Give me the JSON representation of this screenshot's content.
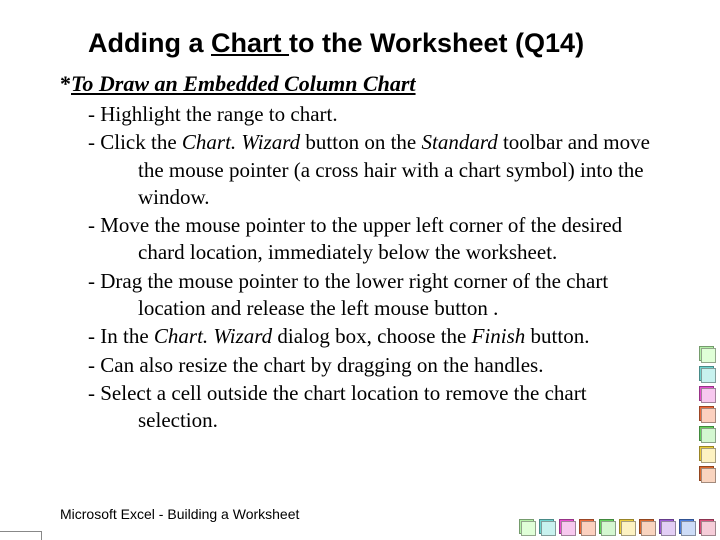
{
  "title": {
    "pre": "Adding a ",
    "underlined": "Chart ",
    "post": "to the Worksheet (Q14)"
  },
  "section_head": {
    "asterisk": "* ",
    "text": "To Draw an Embedded Column Chart"
  },
  "bullets": [
    {
      "pre": "- Highlight the range to chart."
    },
    {
      "pre": "- Click the ",
      "em1": "Chart. Wizard",
      "mid1": " button on the ",
      "em2": "Standard",
      "post": " toolbar and move the mouse pointer (a cross hair with a chart symbol) into the window."
    },
    {
      "pre": "- Move the mouse pointer to the upper left corner of the desired chard location, immediately below the worksheet."
    },
    {
      "pre": "- Drag the mouse pointer to the lower right corner of the chart location and release the left mouse button ."
    },
    {
      "pre": "- In the ",
      "em1": "Chart. Wizard",
      "mid1": " dialog box, choose the ",
      "em2": "Finish",
      "post": " button."
    },
    {
      "pre": "- Can also resize the chart by dragging on the handles."
    },
    {
      "pre": "- Select a cell outside the chart location to remove the chart selection."
    }
  ],
  "footer": "Microsoft  Excel - Building a Worksheet"
}
